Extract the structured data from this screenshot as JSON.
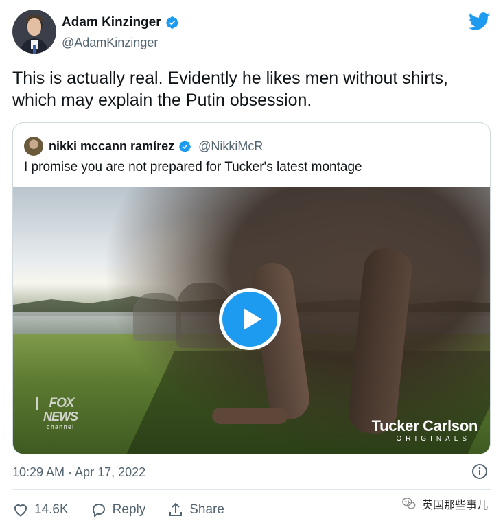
{
  "author": {
    "display_name": "Adam Kinzinger",
    "handle": "@AdamKinzinger"
  },
  "tweet": {
    "text_line1": "This is actually real.  Evidently he likes men without shirts,",
    "text_line2": "which may explain the Putin obsession."
  },
  "quote": {
    "display_name": "nikki mccann ramírez",
    "handle": "@NikkiMcR",
    "text": "I promise you are not prepared for Tucker's latest montage",
    "media": {
      "network_logo": {
        "line1": "FOX",
        "line2": "NEWS",
        "line3": "channel"
      },
      "show_title": "Tucker Carlson",
      "show_subtitle": "ORIGINALS"
    }
  },
  "meta": {
    "timestamp": "10:29 AM · Apr 17, 2022"
  },
  "actions": {
    "like_count": "14.6K",
    "reply_label": "Reply",
    "share_label": "Share"
  },
  "watermark": {
    "text": "英国那些事儿"
  },
  "colors": {
    "verified": "#1d9bf0",
    "twitter_blue": "#1d9bf0",
    "secondary_text": "#536471",
    "border": "#cfd9de"
  },
  "icons": [
    "verified-badge-icon",
    "twitter-bird-icon",
    "play-icon",
    "info-icon",
    "heart-icon",
    "reply-icon",
    "share-icon",
    "wechat-icon"
  ]
}
